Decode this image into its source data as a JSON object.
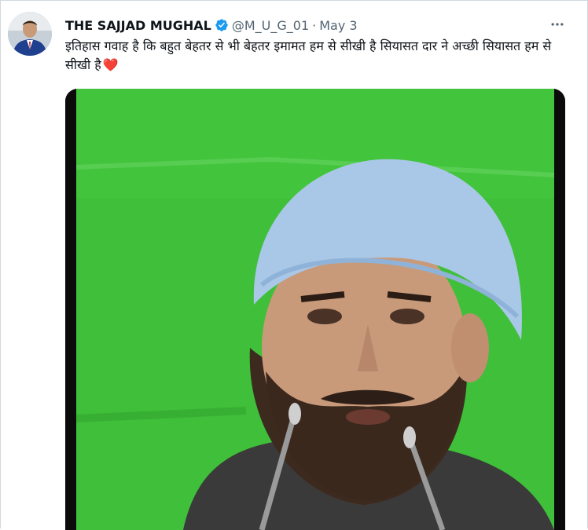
{
  "tweet": {
    "author_name": "THE SAJJAD MUGHAL",
    "handle": "@M_U_G_01",
    "separator": "·",
    "date": "May 3",
    "verified_icon": "verified-badge-icon",
    "more_icon": "more-options-icon",
    "text": "इतिहास गवाह है कि बहुत बेहतर से भी बेहतर इमामत हम से सीखी है सियासत दार ने अच्छी सियासत हम से सीखी है",
    "emoji": "❤️"
  },
  "colors": {
    "verified": "#1d9bf0",
    "secondary_text": "#536471",
    "heart": "#e0245e",
    "video_green": "#3fbf3a"
  }
}
